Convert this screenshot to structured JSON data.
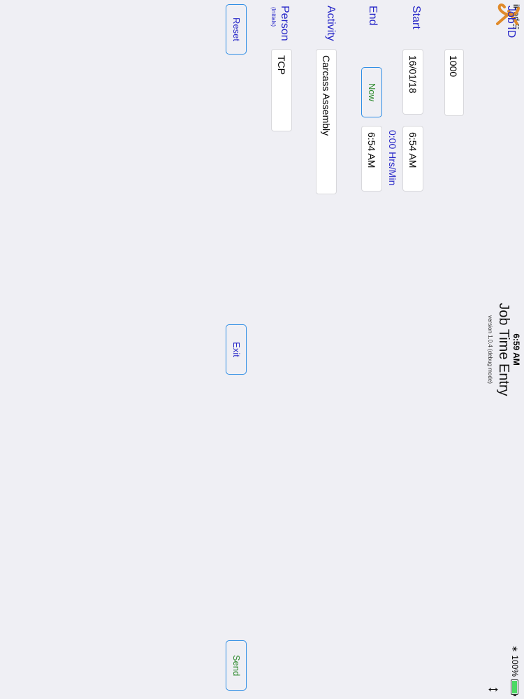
{
  "status_bar": {
    "carrier": "iPad",
    "time": "6:59 AM",
    "battery_text": "100%"
  },
  "header": {
    "title": "Job Time Entry",
    "subtitle": "version 1.0.4 (debug mode)",
    "logo_icon": "jk-logo-icon",
    "expand_icon": "expand-vertical-icon"
  },
  "form": {
    "job_id": {
      "label": "Job ID",
      "value": "1000"
    },
    "start": {
      "label": "Start",
      "date": "16/01/18",
      "time": "6:54 AM"
    },
    "duration": "0:00 Hrs/Min",
    "end": {
      "label": "End",
      "now_label": "Now",
      "time": "6:54 AM"
    },
    "activity": {
      "label": "Activity",
      "value": "Carcass Assembly"
    },
    "person": {
      "label": "Person",
      "sublabel": "(Initials)",
      "value": "TCP"
    }
  },
  "actions": {
    "reset": "Reset",
    "exit": "Exit",
    "send": "Send"
  },
  "colors": {
    "label_blue": "#2727c8",
    "accent_green": "#2d8a2d",
    "button_border": "#2f8ee5",
    "background": "#efeff4",
    "logo_orange": "#e08a2a"
  }
}
